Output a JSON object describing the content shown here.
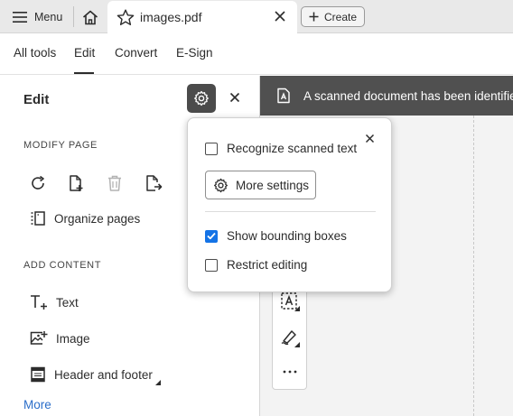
{
  "tabbar": {
    "menu_label": "Menu",
    "doc_tab_title": "images.pdf",
    "create_label": "Create"
  },
  "nav": {
    "items": [
      "All tools",
      "Edit",
      "Convert",
      "E-Sign"
    ],
    "active": "Edit"
  },
  "panel": {
    "title": "Edit",
    "modify_page_heading": "MODIFY PAGE",
    "modify_tools": [
      "rotate-icon",
      "insert-page-icon",
      "delete-icon",
      "extract-page-icon"
    ],
    "organize_pages_label": "Organize pages",
    "add_content_heading": "ADD CONTENT",
    "add_content_items": [
      "Text",
      "Image",
      "Header and footer"
    ],
    "more_label": "More"
  },
  "banner": {
    "text": "A scanned document has been identified, S"
  },
  "popover": {
    "recognize_label": "Recognize scanned text",
    "recognize_checked": false,
    "more_settings_label": "More settings",
    "bounding_boxes_label": "Show bounding boxes",
    "bounding_boxes_checked": true,
    "restrict_label": "Restrict editing",
    "restrict_checked": false
  },
  "vertical_toolbar": {
    "more_label": "..."
  },
  "colors": {
    "accent": "#1473e6",
    "link": "#2b6ec9",
    "banner_bg": "#505050",
    "gear_button_bg": "#4b4b4b"
  }
}
